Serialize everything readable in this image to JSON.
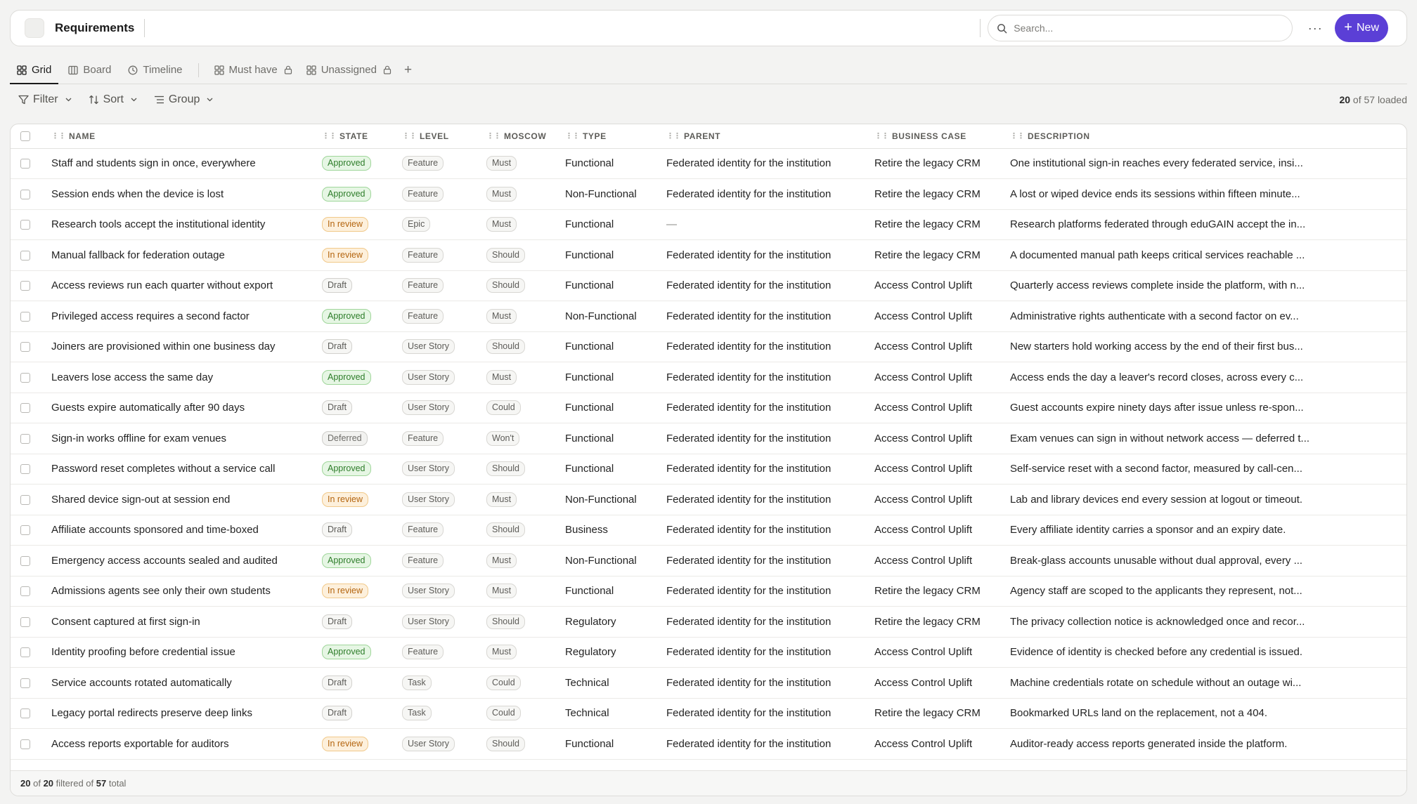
{
  "header": {
    "title": "Requirements",
    "search_placeholder": "Search...",
    "more_label": "···",
    "new_label": "New"
  },
  "tabs": [
    {
      "label": "Grid",
      "icon": "grid-icon",
      "active": true
    },
    {
      "label": "Board",
      "icon": "board-icon"
    },
    {
      "label": "Timeline",
      "icon": "clock-icon"
    },
    {
      "label": "Must have",
      "icon": "grid-icon",
      "locked": true
    },
    {
      "label": "Unassigned",
      "icon": "grid-icon",
      "locked": true
    }
  ],
  "toolbar": {
    "filter": "Filter",
    "sort": "Sort",
    "group": "Group",
    "loaded_count": "20",
    "loaded_of": "of 57 loaded"
  },
  "columns": {
    "name": "NAME",
    "state": "STATE",
    "level": "LEVEL",
    "moscow": "MOSCOW",
    "type": "TYPE",
    "parent": "PARENT",
    "business_case": "BUSINESS CASE",
    "description": "DESCRIPTION"
  },
  "rows": [
    {
      "name": "Staff and students sign in once, everywhere",
      "state": "Approved",
      "level": "Feature",
      "moscow": "Must",
      "type": "Functional",
      "parent": "Federated identity for the institution",
      "business_case": "Retire the legacy CRM",
      "description": "One institutional sign-in reaches every federated service, insi..."
    },
    {
      "name": "Session ends when the device is lost",
      "state": "Approved",
      "level": "Feature",
      "moscow": "Must",
      "type": "Non-Functional",
      "parent": "Federated identity for the institution",
      "business_case": "Retire the legacy CRM",
      "description": "A lost or wiped device ends its sessions within fifteen minute..."
    },
    {
      "name": "Research tools accept the institutional identity",
      "state": "In review",
      "level": "Epic",
      "moscow": "Must",
      "type": "Functional",
      "parent": "—",
      "business_case": "Retire the legacy CRM",
      "description": "Research platforms federated through eduGAIN accept the in..."
    },
    {
      "name": "Manual fallback for federation outage",
      "state": "In review",
      "level": "Feature",
      "moscow": "Should",
      "type": "Functional",
      "parent": "Federated identity for the institution",
      "business_case": "Retire the legacy CRM",
      "description": "A documented manual path keeps critical services reachable ..."
    },
    {
      "name": "Access reviews run each quarter without export",
      "state": "Draft",
      "level": "Feature",
      "moscow": "Should",
      "type": "Functional",
      "parent": "Federated identity for the institution",
      "business_case": "Access Control Uplift",
      "description": "Quarterly access reviews complete inside the platform, with n..."
    },
    {
      "name": "Privileged access requires a second factor",
      "state": "Approved",
      "level": "Feature",
      "moscow": "Must",
      "type": "Non-Functional",
      "parent": "Federated identity for the institution",
      "business_case": "Access Control Uplift",
      "description": "Administrative rights authenticate with a second factor on ev..."
    },
    {
      "name": "Joiners are provisioned within one business day",
      "state": "Draft",
      "level": "User Story",
      "moscow": "Should",
      "type": "Functional",
      "parent": "Federated identity for the institution",
      "business_case": "Access Control Uplift",
      "description": "New starters hold working access by the end of their first bus..."
    },
    {
      "name": "Leavers lose access the same day",
      "state": "Approved",
      "level": "User Story",
      "moscow": "Must",
      "type": "Functional",
      "parent": "Federated identity for the institution",
      "business_case": "Access Control Uplift",
      "description": "Access ends the day a leaver's record closes, across every c..."
    },
    {
      "name": "Guests expire automatically after 90 days",
      "state": "Draft",
      "level": "User Story",
      "moscow": "Could",
      "type": "Functional",
      "parent": "Federated identity for the institution",
      "business_case": "Access Control Uplift",
      "description": "Guest accounts expire ninety days after issue unless re-spon..."
    },
    {
      "name": "Sign-in works offline for exam venues",
      "state": "Deferred",
      "level": "Feature",
      "moscow": "Won't",
      "type": "Functional",
      "parent": "Federated identity for the institution",
      "business_case": "Access Control Uplift",
      "description": "Exam venues can sign in without network access — deferred t..."
    },
    {
      "name": "Password reset completes without a service call",
      "state": "Approved",
      "level": "User Story",
      "moscow": "Should",
      "type": "Functional",
      "parent": "Federated identity for the institution",
      "business_case": "Access Control Uplift",
      "description": "Self-service reset with a second factor, measured by call-cen..."
    },
    {
      "name": "Shared device sign-out at session end",
      "state": "In review",
      "level": "User Story",
      "moscow": "Must",
      "type": "Non-Functional",
      "parent": "Federated identity for the institution",
      "business_case": "Access Control Uplift",
      "description": "Lab and library devices end every session at logout or timeout."
    },
    {
      "name": "Affiliate accounts sponsored and time-boxed",
      "state": "Draft",
      "level": "Feature",
      "moscow": "Should",
      "type": "Business",
      "parent": "Federated identity for the institution",
      "business_case": "Access Control Uplift",
      "description": "Every affiliate identity carries a sponsor and an expiry date."
    },
    {
      "name": "Emergency access accounts sealed and audited",
      "state": "Approved",
      "level": "Feature",
      "moscow": "Must",
      "type": "Non-Functional",
      "parent": "Federated identity for the institution",
      "business_case": "Access Control Uplift",
      "description": "Break-glass accounts unusable without dual approval, every ..."
    },
    {
      "name": "Admissions agents see only their own students",
      "state": "In review",
      "level": "User Story",
      "moscow": "Must",
      "type": "Functional",
      "parent": "Federated identity for the institution",
      "business_case": "Retire the legacy CRM",
      "description": "Agency staff are scoped to the applicants they represent, not..."
    },
    {
      "name": "Consent captured at first sign-in",
      "state": "Draft",
      "level": "User Story",
      "moscow": "Should",
      "type": "Regulatory",
      "parent": "Federated identity for the institution",
      "business_case": "Retire the legacy CRM",
      "description": "The privacy collection notice is acknowledged once and recor..."
    },
    {
      "name": "Identity proofing before credential issue",
      "state": "Approved",
      "level": "Feature",
      "moscow": "Must",
      "type": "Regulatory",
      "parent": "Federated identity for the institution",
      "business_case": "Access Control Uplift",
      "description": "Evidence of identity is checked before any credential is issued."
    },
    {
      "name": "Service accounts rotated automatically",
      "state": "Draft",
      "level": "Task",
      "moscow": "Could",
      "type": "Technical",
      "parent": "Federated identity for the institution",
      "business_case": "Access Control Uplift",
      "description": "Machine credentials rotate on schedule without an outage wi..."
    },
    {
      "name": "Legacy portal redirects preserve deep links",
      "state": "Draft",
      "level": "Task",
      "moscow": "Could",
      "type": "Technical",
      "parent": "Federated identity for the institution",
      "business_case": "Retire the legacy CRM",
      "description": "Bookmarked URLs land on the replacement, not a 404."
    },
    {
      "name": "Access reports exportable for auditors",
      "state": "In review",
      "level": "User Story",
      "moscow": "Should",
      "type": "Functional",
      "parent": "Federated identity for the institution",
      "business_case": "Access Control Uplift",
      "description": "Auditor-ready access reports generated inside the platform."
    }
  ],
  "footer": {
    "shown": "20",
    "of_label": "of",
    "filtered": "20",
    "filtered_label": "filtered of",
    "total": "57",
    "total_label": "total"
  },
  "colors": {
    "accent": "#5b3fd6",
    "approved": "#2e7d2a",
    "in_review": "#b4650f"
  }
}
